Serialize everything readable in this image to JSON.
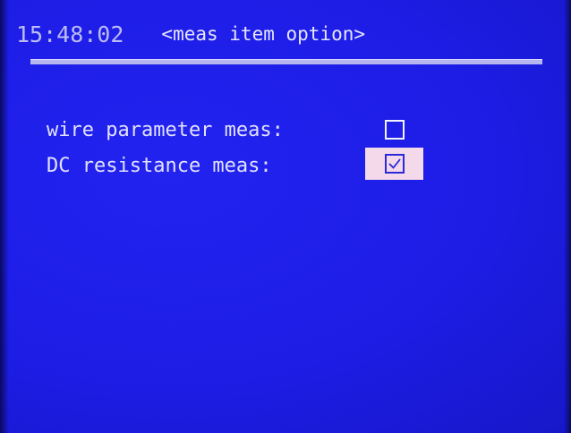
{
  "header": {
    "clock": "15:48:02",
    "title": "<meas item option>"
  },
  "options": [
    {
      "label": "wire parameter meas:",
      "checked": false
    },
    {
      "label": "DC resistance meas:",
      "checked": true,
      "selected": true
    }
  ],
  "colors": {
    "background": "#1c1ce6",
    "text": "#e2e2ff",
    "selection_highlight": "#f3d9ea"
  },
  "icons": {
    "unchecked": "checkbox-empty-icon",
    "checked": "checkbox-checked-icon"
  }
}
